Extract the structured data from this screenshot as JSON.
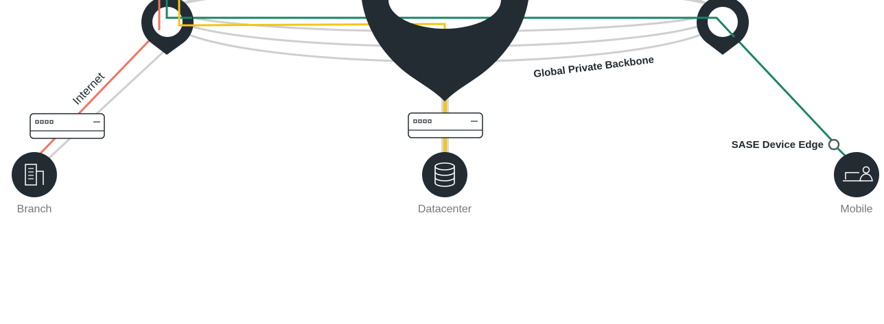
{
  "diagram": {
    "labels": {
      "internet": "Internet",
      "backbone": "Global Private Backbone",
      "sase_device_edge": "SASE Device Edge",
      "branch": "Branch",
      "datacenter": "Datacenter",
      "mobile": "Mobile"
    },
    "colors": {
      "dark": "#232c33",
      "backbone_ring": "#cfcfcf",
      "internet_link": "#f07561",
      "green_link": "#1a8567",
      "yellow_link": "#f5c518",
      "device_text": "#222b31",
      "label_gray": "#777777"
    },
    "icons": {
      "branch": "building-icon",
      "datacenter": "database-icon",
      "mobile": "laptop-user-icon",
      "edge_device": "router-appliance-icon",
      "pop": "location-pin-icon"
    }
  }
}
